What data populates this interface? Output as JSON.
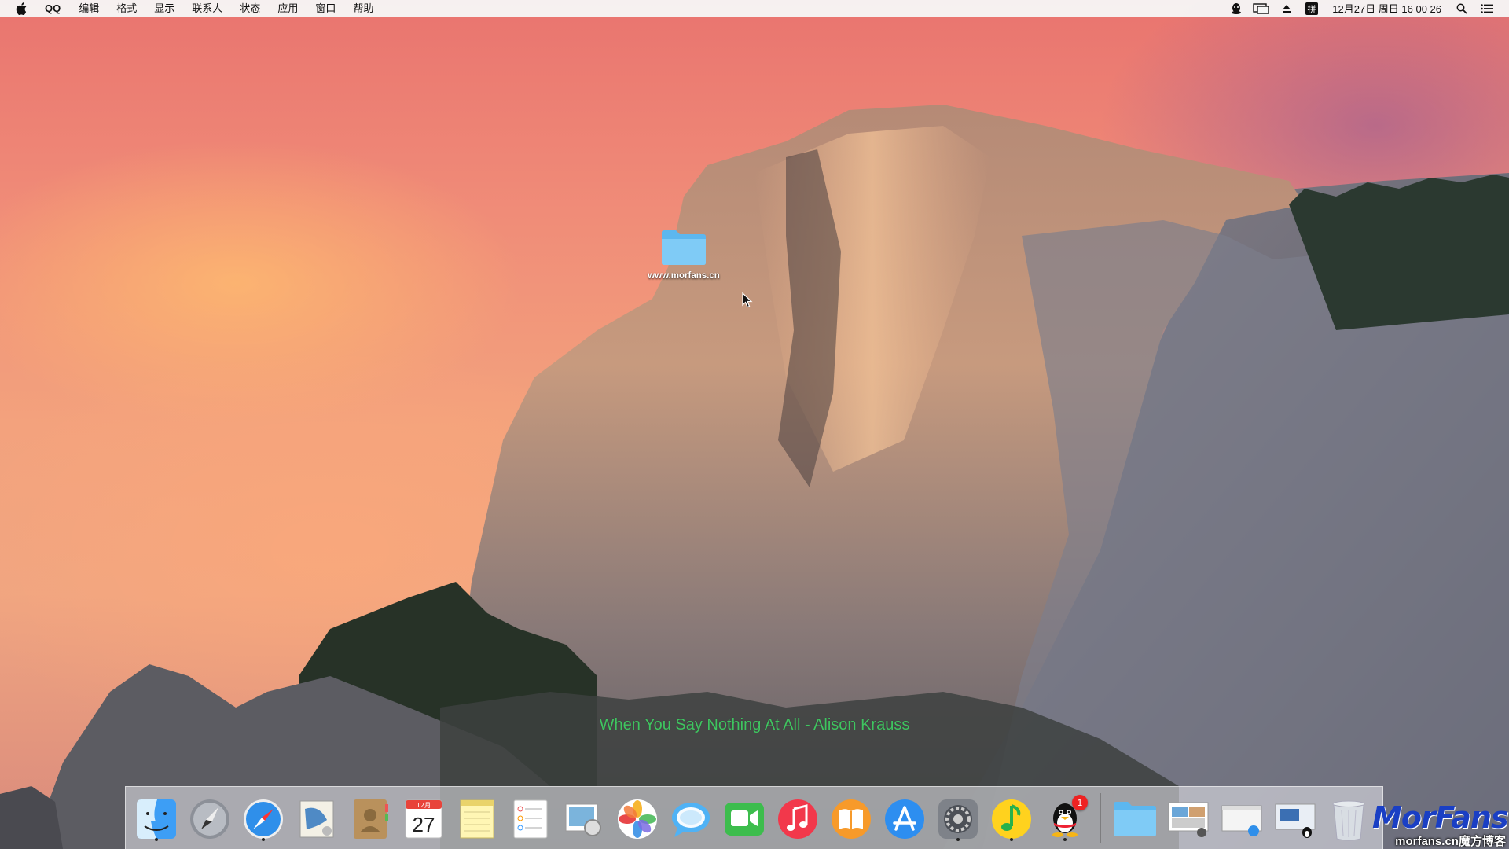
{
  "menubar": {
    "app_name": "QQ",
    "items": [
      "编辑",
      "格式",
      "显示",
      "联系人",
      "状态",
      "应用",
      "窗口",
      "帮助"
    ],
    "clock": "12月27日 周日 16 00 26",
    "status_icons": [
      "qq-bell-icon",
      "display-icon",
      "eject-icon",
      "input-method-icon",
      "spotlight-icon",
      "notification-center-icon"
    ],
    "input_method_glyph": "拼"
  },
  "desktop": {
    "folder_label": "www.morfans.cn"
  },
  "lyrics": "When You Say Nothing At All - Alison Krauss",
  "dock": {
    "calendar_month": "12月",
    "calendar_day": "27",
    "qq_badge": "1",
    "apps": [
      "finder",
      "launchpad",
      "safari",
      "mail",
      "contacts",
      "calendar",
      "notes",
      "reminders",
      "preview",
      "photos",
      "messages",
      "facetime",
      "itunes",
      "ibooks",
      "app-store",
      "system-preferences",
      "qq-music",
      "qq"
    ]
  },
  "watermark": {
    "logo": "MorFans",
    "url": "morfans.cn",
    "suffix": "魔方博客"
  }
}
